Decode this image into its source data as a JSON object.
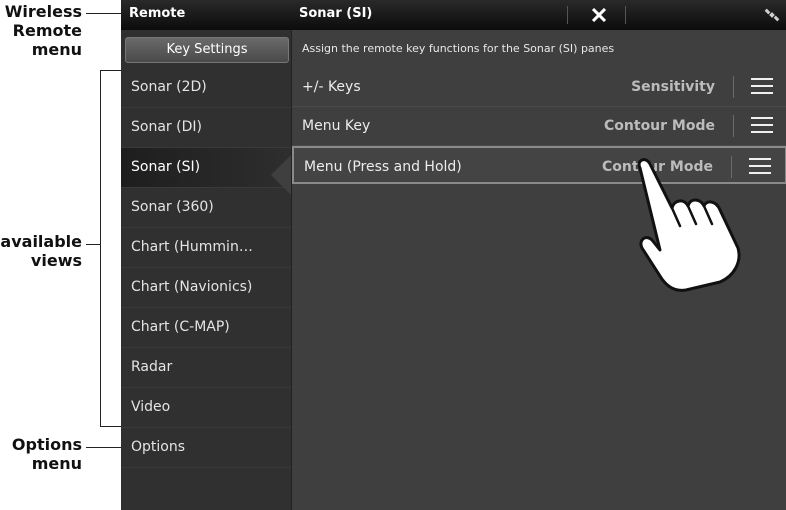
{
  "callouts": {
    "wireless": [
      "Wireless",
      "Remote",
      "menu"
    ],
    "views": [
      "available",
      "views"
    ],
    "options": [
      "Options",
      "menu"
    ]
  },
  "titlebar": {
    "left_title": "Remote",
    "center_title": "Sonar (SI)",
    "close_icon": "close-icon",
    "status_icon": "satellite-icon"
  },
  "sidebar": {
    "header": "Key Settings",
    "items": [
      {
        "label": "Sonar (2D)"
      },
      {
        "label": "Sonar (DI)"
      },
      {
        "label": "Sonar (SI)",
        "selected": true
      },
      {
        "label": "Sonar (360)"
      },
      {
        "label": "Chart (Hummin…"
      },
      {
        "label": "Chart (Navionics)"
      },
      {
        "label": "Chart (C-MAP)"
      },
      {
        "label": "Radar"
      },
      {
        "label": "Video"
      },
      {
        "label": "Options"
      }
    ]
  },
  "main": {
    "subtitle": "Assign the remote key functions for the Sonar (SI) panes",
    "rows": [
      {
        "label": "+/- Keys",
        "value": "Sensitivity"
      },
      {
        "label": "Menu Key",
        "value": "Contour Mode"
      },
      {
        "label": "Menu (Press and Hold)",
        "value": "Contour Mode",
        "active": true
      }
    ]
  },
  "colors": {
    "accent": "#8a8a8a",
    "panel": "#3f3f3f",
    "sidebar": "#303030"
  }
}
